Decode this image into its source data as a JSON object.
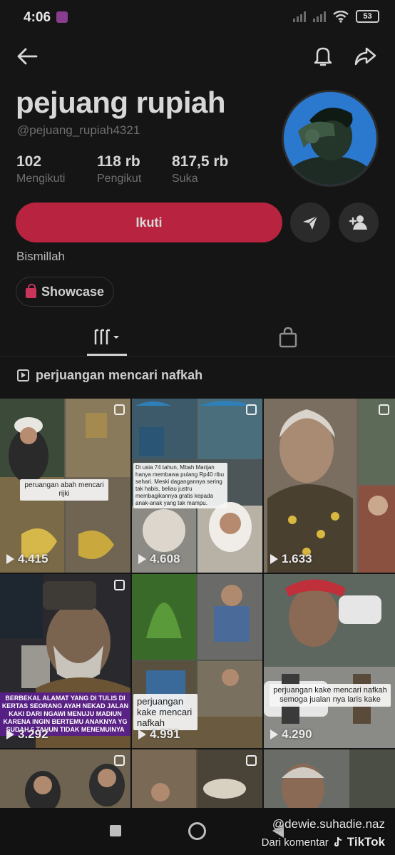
{
  "status_bar": {
    "time": "4:06",
    "battery": "53"
  },
  "profile": {
    "name": "pejuang rupiah",
    "handle": "@pejuang_rupiah4321",
    "stats": [
      {
        "value": "102",
        "label": "Mengikuti"
      },
      {
        "value": "118 rb",
        "label": "Pengikut"
      },
      {
        "value": "817,5 rb",
        "label": "Suka"
      }
    ],
    "follow_label": "Ikuti",
    "bio": "Bismillah",
    "showcase_label": "Showcase"
  },
  "playlist": {
    "title": "perjuangan mencari nafkah"
  },
  "videos": [
    {
      "caption": "peruangan abah mencari rijki",
      "views": "4.415"
    },
    {
      "caption": "Di usia 74 tahun, Mbah Marijan hanya membawa pulang Rp40 ribu sehari. Meski dagangannya sering tak habis, beliau justru membagikannya gratis kepada anak-anak yang tak mampu.",
      "views": "4.608"
    },
    {
      "caption": "",
      "views": "1.633"
    },
    {
      "caption": "BERBEKAL ALAMAT YANG DI TULIS DI KERTAS SEORANG AYAH NEKAD JALAN KAKI DARI NGAWI MENUJU MADIUN KARENA INGIN BERTEMU ANAKNYA YG SUDAH 6 TAHUN TIDAK MENEMUINYA",
      "views": "3.292"
    },
    {
      "caption": "perjuangan kake mencari nafkah",
      "views": "4.991"
    },
    {
      "caption": "perjuangan kake mencari nafkah semoga jualan nya laris kake",
      "views": "4.290"
    }
  ],
  "watermark": {
    "user": "@dewie.suhadie.naz",
    "prefix": "Dari komentar",
    "brand": "TikTok"
  },
  "colors": {
    "accent": "#b8243f",
    "background": "#151515"
  }
}
